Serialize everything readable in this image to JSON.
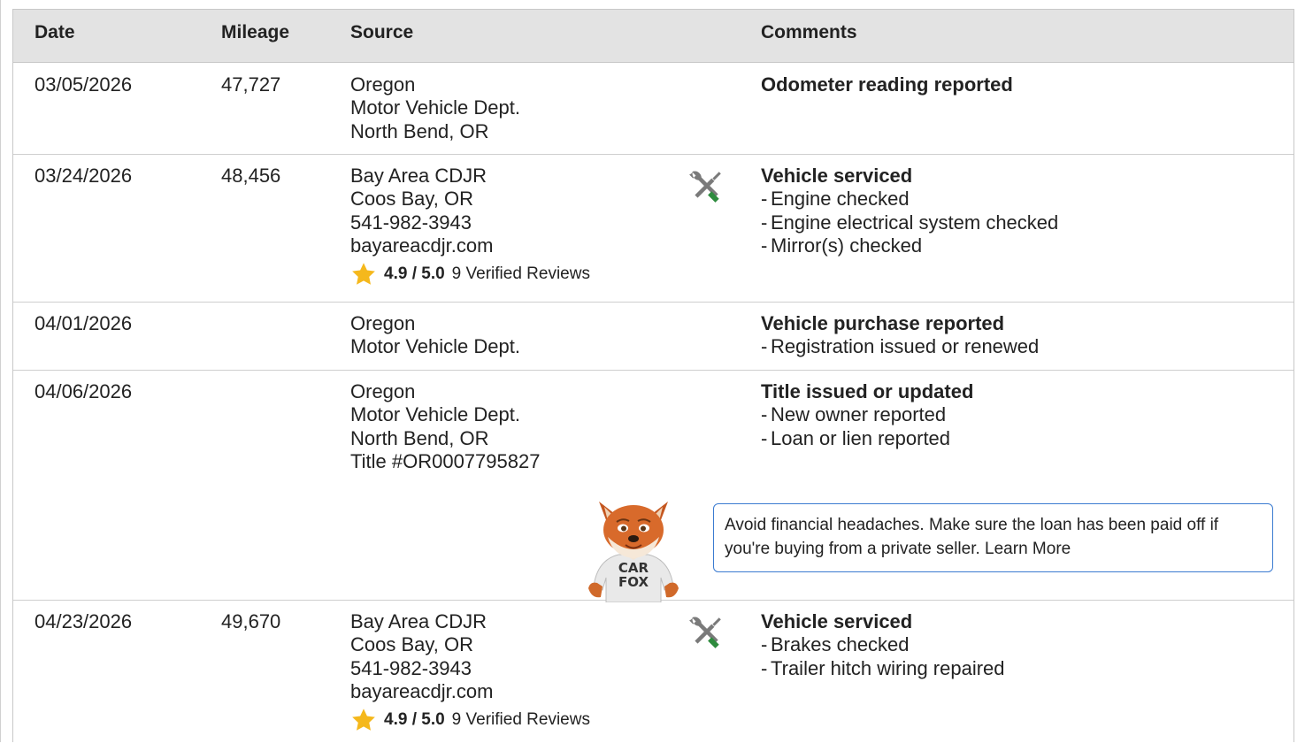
{
  "table": {
    "headers": {
      "date": "Date",
      "mileage": "Mileage",
      "source": "Source",
      "comments": "Comments"
    },
    "rows": [
      {
        "date": "03/05/2026",
        "mileage": "47,727",
        "source": [
          "Oregon",
          "Motor Vehicle Dept.",
          "North Bend, OR"
        ],
        "comment_title": "Odometer reading reported",
        "comment_items": []
      },
      {
        "date": "03/24/2026",
        "mileage": "48,456",
        "source": [
          "Bay Area CDJR",
          "Coos Bay, OR",
          "541-982-3943",
          "bayareacdjr.com"
        ],
        "rating": {
          "score": "4.9 / 5.0",
          "reviews": "9 Verified Reviews"
        },
        "icon": "service-tools-icon",
        "comment_title": "Vehicle serviced",
        "comment_items": [
          "Engine checked",
          "Engine electrical system checked",
          "Mirror(s) checked"
        ]
      },
      {
        "date": "04/01/2026",
        "mileage": "",
        "source": [
          "Oregon",
          "Motor Vehicle Dept."
        ],
        "comment_title": "Vehicle purchase reported",
        "comment_items": [
          "Registration issued or renewed"
        ]
      },
      {
        "date": "04/06/2026",
        "mileage": "",
        "source": [
          "Oregon",
          "Motor Vehicle Dept.",
          "North Bend, OR",
          "Title #OR0007795827"
        ],
        "comment_title": "Title issued or updated",
        "comment_items": [
          "New owner reported",
          "Loan or lien reported"
        ],
        "callout": "Avoid financial headaches. Make sure the loan has been paid off if you're buying from a private seller. Learn More",
        "mascot_shirt": "CAR FOX"
      },
      {
        "date": "04/23/2026",
        "mileage": "49,670",
        "source": [
          "Bay Area CDJR",
          "Coos Bay, OR",
          "541-982-3943",
          "bayareacdjr.com"
        ],
        "rating": {
          "score": "4.9 / 5.0",
          "reviews": "9 Verified Reviews"
        },
        "icon": "service-tools-icon",
        "comment_title": "Vehicle serviced",
        "comment_items": [
          "Brakes checked",
          "Trailer hitch wiring repaired"
        ]
      }
    ]
  },
  "dash": "-",
  "colors": {
    "header_bg": "#e3e3e3",
    "star": "#f5b81c",
    "wrench_green": "#2e8b3e",
    "tool_gray": "#7a7a7a",
    "callout_border": "#3b7bd1"
  }
}
